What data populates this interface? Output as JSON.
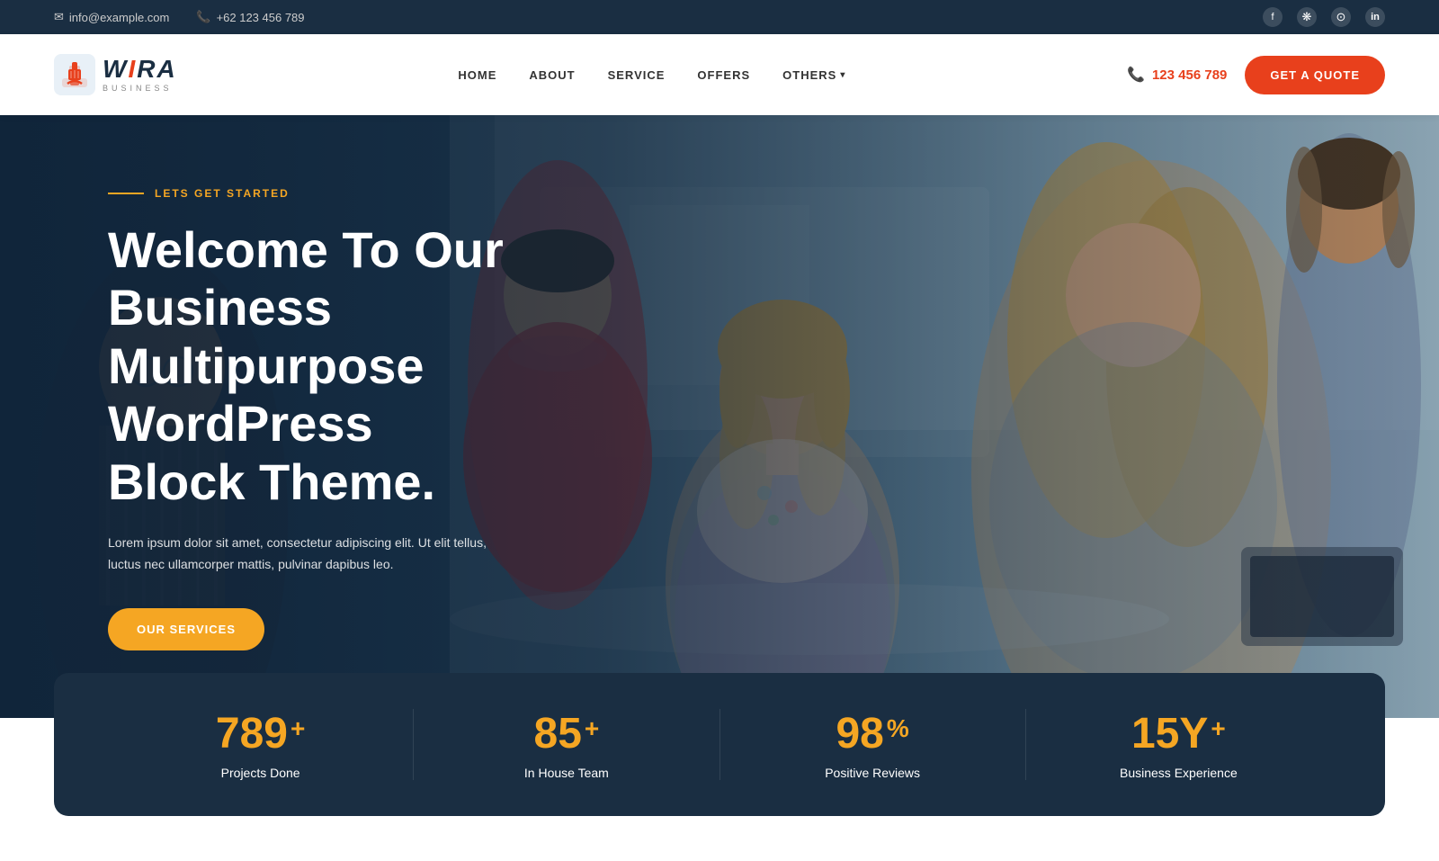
{
  "topbar": {
    "email": "info@example.com",
    "phone": "+62 123 456 789",
    "email_icon": "✉",
    "phone_icon": "📞"
  },
  "social": {
    "facebook": "f",
    "dribbble": "❋",
    "instagram": "⊙",
    "linkedin": "in"
  },
  "navbar": {
    "logo_name": "WIRA",
    "logo_sub": "BUSINESS",
    "links": [
      "HOME",
      "ABOUT",
      "SERVICE",
      "OFFERS"
    ],
    "others_label": "OTHERS",
    "phone": "123 456 789",
    "quote_label": "GET A QUOTE"
  },
  "hero": {
    "subtitle": "LETS GET STARTED",
    "title_line1": "Welcome To Our Business",
    "title_line2": "Multipurpose WordPress",
    "title_line3": "Block Theme.",
    "description": "Lorem ipsum dolor sit amet, consectetur adipiscing elit. Ut elit tellus, luctus nec ullamcorper mattis, pulvinar dapibus leo.",
    "cta_label": "OUR SERVICES"
  },
  "stats": [
    {
      "number": "789",
      "suffix": "+",
      "label": "Projects Done"
    },
    {
      "number": "85",
      "suffix": "+",
      "label": "In House Team"
    },
    {
      "number": "98",
      "suffix": "%",
      "label": "Positive Reviews"
    },
    {
      "number": "15Y",
      "suffix": "+",
      "label": "Business Experience"
    }
  ],
  "colors": {
    "primary": "#1a2e42",
    "accent": "#e8401c",
    "gold": "#f5a623"
  }
}
